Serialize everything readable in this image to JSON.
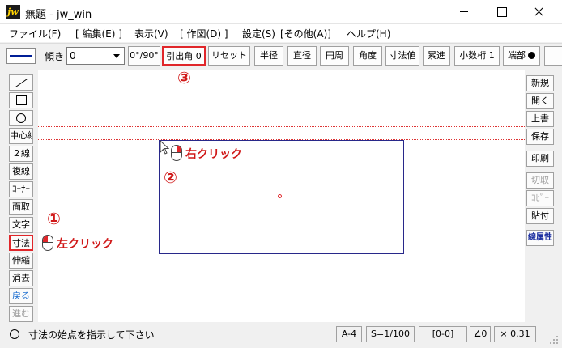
{
  "window": {
    "title": "無題 - jw_win",
    "app_icon": "jw",
    "controls": [
      "minimize-icon",
      "maximize-icon",
      "close-icon"
    ]
  },
  "menu": [
    "ファイル(F)",
    "[ 編集(E) ]",
    "表示(V)",
    "[ 作図(D) ]",
    "設定(S)",
    "[その他(A)]",
    "ヘルプ(H)"
  ],
  "toolbar": {
    "tilt_label": "傾き",
    "tilt_value": "0",
    "buttons": [
      "0°/90°",
      "引出角 0",
      "リセット",
      "半径",
      "直径",
      "円周",
      "角度",
      "寸法値",
      "累進",
      "小数桁 1",
      "端部"
    ],
    "highlighted": "引出角 0"
  },
  "left_tools": [
    "／",
    "□",
    "○",
    "中心線",
    "２線",
    "複線",
    "ｺｰﾅｰ",
    "面取",
    "文字",
    "寸法",
    "伸縮",
    "消去",
    "戻る",
    "進む"
  ],
  "right_tools": [
    "新規",
    "開く",
    "上書",
    "保存",
    "印刷",
    "切取",
    "ｺﾋﾟｰ",
    "貼付",
    "線属性"
  ],
  "annotations": {
    "step1_number": "①",
    "step1_text": "左クリック",
    "step2_number": "②",
    "step2_text": "右クリック",
    "step3_number": "③"
  },
  "colors": {
    "highlight": "#e0262a",
    "annotation": "#d01818",
    "paper_frame": "#28288a",
    "guide_line": "#dd3333"
  },
  "status": {
    "message": "寸法の始点を指示して下さい",
    "paper": "A-4",
    "scale": "S=1/100",
    "layer": "[0-0]",
    "angle": "∠0",
    "zoom": "× 0.31"
  }
}
